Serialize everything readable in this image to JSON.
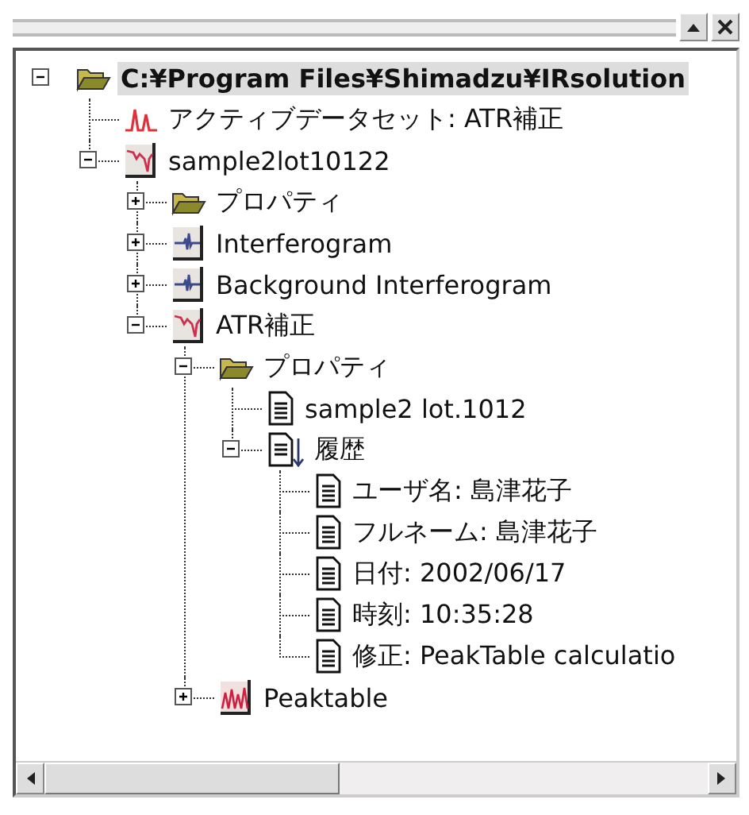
{
  "tree": [
    {
      "label": "C:¥Program Files¥Shimadzu¥IRsolution",
      "kind": "folder",
      "expanded": true,
      "selected": true,
      "children": [
        {
          "label": "アクティブデータセット: ATR補正",
          "kind": "spectrum",
          "selected": false
        },
        {
          "label": "sample2lot10122",
          "kind": "spectrum-file",
          "expanded": true,
          "selected": false,
          "children": [
            {
              "label": "プロパティ",
              "kind": "folder",
              "expanded": false,
              "selected": false
            },
            {
              "label": "Interferogram",
              "kind": "interferogram",
              "expanded": false,
              "selected": false
            },
            {
              "label": "Background Interferogram",
              "kind": "interferogram",
              "expanded": false,
              "selected": false
            },
            {
              "label": "ATR補正",
              "kind": "spectrum-file",
              "expanded": true,
              "selected": false,
              "children": [
                {
                  "label": "プロパティ",
                  "kind": "folder",
                  "expanded": true,
                  "selected": false,
                  "children": [
                    {
                      "label": "sample2 lot.1012",
                      "kind": "document",
                      "selected": false
                    },
                    {
                      "label": "履歴",
                      "kind": "history",
                      "expanded": true,
                      "selected": false,
                      "children": [
                        {
                          "label": "ユーザ名: 島津花子",
                          "kind": "document",
                          "selected": false
                        },
                        {
                          "label": "フルネーム: 島津花子",
                          "kind": "document",
                          "selected": false
                        },
                        {
                          "label": "日付: 2002/06/17",
                          "kind": "document",
                          "selected": false
                        },
                        {
                          "label": "時刻: 10:35:28",
                          "kind": "document",
                          "selected": false
                        },
                        {
                          "label": "修正: PeakTable calculatio",
                          "kind": "document",
                          "selected": false
                        }
                      ]
                    }
                  ]
                },
                {
                  "label": "Peaktable",
                  "kind": "peaktable",
                  "expanded": false,
                  "selected": false
                }
              ]
            }
          ]
        }
      ]
    }
  ]
}
